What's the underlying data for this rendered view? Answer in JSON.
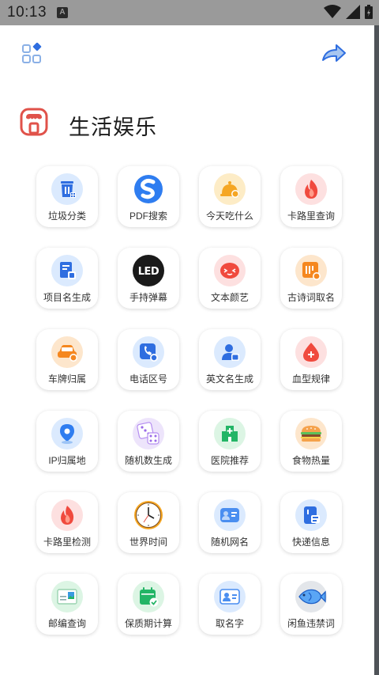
{
  "status": {
    "time": "10:13",
    "badge": "A"
  },
  "section": {
    "title": "生活娱乐"
  },
  "tools": [
    {
      "label": "垃圾分类",
      "icon": "trash-bin-icon",
      "bg": "#dbeafe"
    },
    {
      "label": "PDF搜索",
      "icon": "sogou-search-icon",
      "bg": "#ffffff"
    },
    {
      "label": "今天吃什么",
      "icon": "bell-food-icon",
      "bg": "#fdecc6"
    },
    {
      "label": "卡路里查询",
      "icon": "flame-icon",
      "bg": "#fde0e0"
    },
    {
      "label": "项目名生成",
      "icon": "document-icon",
      "bg": "#dbeafe"
    },
    {
      "label": "手持弹幕",
      "icon": "led-icon",
      "bg": "#1a1a1a"
    },
    {
      "label": "文本颜艺",
      "icon": "emoticon-icon",
      "bg": "#fde0e0"
    },
    {
      "label": "古诗词取名",
      "icon": "poem-icon",
      "bg": "#fde6cc"
    },
    {
      "label": "车牌归属",
      "icon": "car-icon",
      "bg": "#fde6cc"
    },
    {
      "label": "电话区号",
      "icon": "phone-icon",
      "bg": "#dbeafe"
    },
    {
      "label": "英文名生成",
      "icon": "person-icon",
      "bg": "#dbeafe"
    },
    {
      "label": "血型规律",
      "icon": "blood-drop-icon",
      "bg": "#fde0e0"
    },
    {
      "label": "IP归属地",
      "icon": "location-pin-icon",
      "bg": "#dbeafe"
    },
    {
      "label": "随机数生成",
      "icon": "dice-icon",
      "bg": "#ede4fb"
    },
    {
      "label": "医院推荐",
      "icon": "hospital-icon",
      "bg": "#dcf5e4"
    },
    {
      "label": "食物热量",
      "icon": "burger-icon",
      "bg": "#fde6cc"
    },
    {
      "label": "卡路里检测",
      "icon": "flame-icon",
      "bg": "#fde0e0"
    },
    {
      "label": "世界时间",
      "icon": "clock-icon",
      "bg": "#ffffff"
    },
    {
      "label": "随机网名",
      "icon": "id-card-icon",
      "bg": "#dbeafe"
    },
    {
      "label": "快递信息",
      "icon": "package-icon",
      "bg": "#dbeafe"
    },
    {
      "label": "邮编查询",
      "icon": "postcard-icon",
      "bg": "#dcf5e4"
    },
    {
      "label": "保质期计算",
      "icon": "calendar-check-icon",
      "bg": "#dcf5e4"
    },
    {
      "label": "取名字",
      "icon": "name-card-icon",
      "bg": "#dbeafe"
    },
    {
      "label": "闲鱼违禁词",
      "icon": "fish-icon",
      "bg": "#e3e6ea"
    }
  ]
}
